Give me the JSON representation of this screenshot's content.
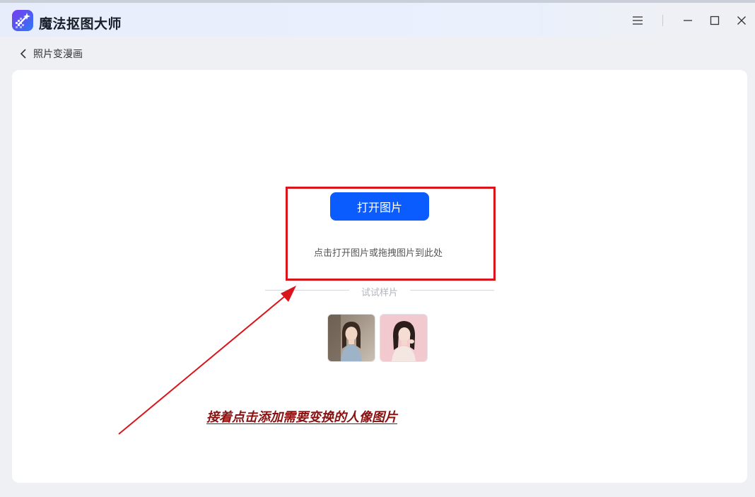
{
  "app": {
    "title": "魔法抠图大师"
  },
  "nav": {
    "back_label": "照片变漫画"
  },
  "upload": {
    "open_button": "打开图片",
    "hint": "点击打开图片或拖拽图片到此处",
    "try_samples_label": "试试样片"
  },
  "annotation": {
    "text": "接着点击添加需要变换的人像图片"
  },
  "colors": {
    "accent": "#0b5cff",
    "highlight_box": "#d9141b",
    "annotation": "#8b1010"
  },
  "icons": {
    "logo": "magic-wand-icon",
    "back": "chevron-left-icon",
    "menu": "hamburger-menu-icon",
    "minimize": "minimize-icon",
    "maximize": "maximize-icon",
    "close": "close-icon"
  }
}
